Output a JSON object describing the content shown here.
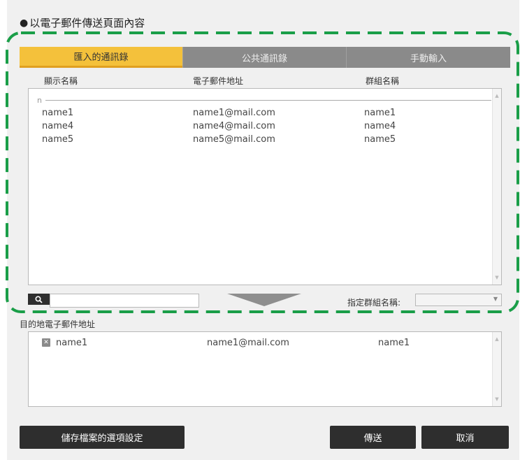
{
  "section": {
    "title": "以電子郵件傳送頁面內容"
  },
  "tabs": [
    {
      "label": "匯入的通訊錄",
      "active": true
    },
    {
      "label": "公共通訊錄",
      "active": false
    },
    {
      "label": "手動輸入",
      "active": false
    }
  ],
  "columns": {
    "name": "顯示名稱",
    "email": "電子郵件地址",
    "group": "群組名稱"
  },
  "address_list": {
    "group_index": "n",
    "rows": [
      {
        "name": "name1",
        "email": "name1@mail.com",
        "group": "name1"
      },
      {
        "name": "name4",
        "email": "name4@mail.com",
        "group": "name4"
      },
      {
        "name": "name5",
        "email": "name5@mail.com",
        "group": "name5"
      }
    ]
  },
  "search": {
    "placeholder": "",
    "icon": "search-icon"
  },
  "group_filter": {
    "label": "指定群組名稱:",
    "selected": ""
  },
  "destination": {
    "label": "目的地電子郵件地址",
    "rows": [
      {
        "name": "name1",
        "email": "name1@mail.com",
        "group": "name1"
      }
    ]
  },
  "buttons": {
    "save_settings": "儲存檔案的選項設定",
    "send": "傳送",
    "cancel": "取消"
  },
  "colors": {
    "active_tab": "#f4c13b",
    "inactive_tab": "#8a8a8a",
    "button": "#2e2e2e",
    "highlight_border": "#1a9e48"
  }
}
